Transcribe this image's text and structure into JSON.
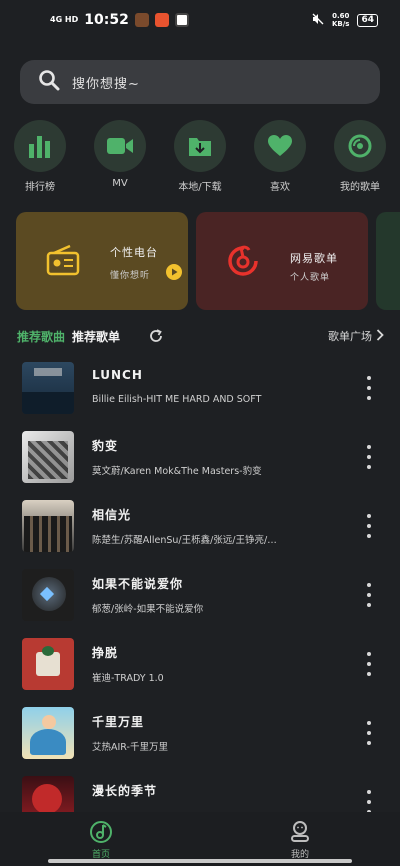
{
  "status": {
    "net": "4G HD",
    "time": "10:52",
    "speed": "0.60\nKB/s",
    "battery": "64"
  },
  "search": {
    "placeholder": "搜你想搜~"
  },
  "quick": [
    {
      "label": "排行榜",
      "icon": "bar-chart-icon"
    },
    {
      "label": "MV",
      "icon": "video-camera-icon"
    },
    {
      "label": "本地/下载",
      "icon": "folder-download-icon"
    },
    {
      "label": "喜欢",
      "icon": "heart-icon"
    },
    {
      "label": "我的歌单",
      "icon": "disc-icon"
    }
  ],
  "cards": [
    {
      "title": "个性电台",
      "subtitle": "懂你想听",
      "icon": "radio-icon",
      "color": "#5b4a22"
    },
    {
      "title": "网易歌单",
      "subtitle": "个人歌单",
      "icon": "netease-icon",
      "color": "#4a2424"
    }
  ],
  "tabs": {
    "recommended_songs": "推荐歌曲",
    "recommended_playlists": "推荐歌单",
    "plaza": "歌单广场"
  },
  "songs": [
    {
      "title": "LUNCH",
      "artist": "Billie Eilish-HIT ME HARD AND SOFT"
    },
    {
      "title": "豹变",
      "artist": "莫文蔚/Karen Mok&The Masters-豹变"
    },
    {
      "title": "相信光",
      "artist": "陈楚生/苏醒AllenSu/王栎鑫/张远/王铮亮/…"
    },
    {
      "title": "如果不能说爱你",
      "artist": "郁葱/张岭-如果不能说爱你"
    },
    {
      "title": "挣脱",
      "artist": "崔迪-TRADY 1.0"
    },
    {
      "title": "千里万里",
      "artist": "艾热AIR-千里万里"
    },
    {
      "title": "漫长的季节",
      "artist": ""
    }
  ],
  "nav": {
    "home": "首页",
    "mine": "我的"
  },
  "colors": {
    "accent": "#4fb26a",
    "background": "#1e2023"
  }
}
